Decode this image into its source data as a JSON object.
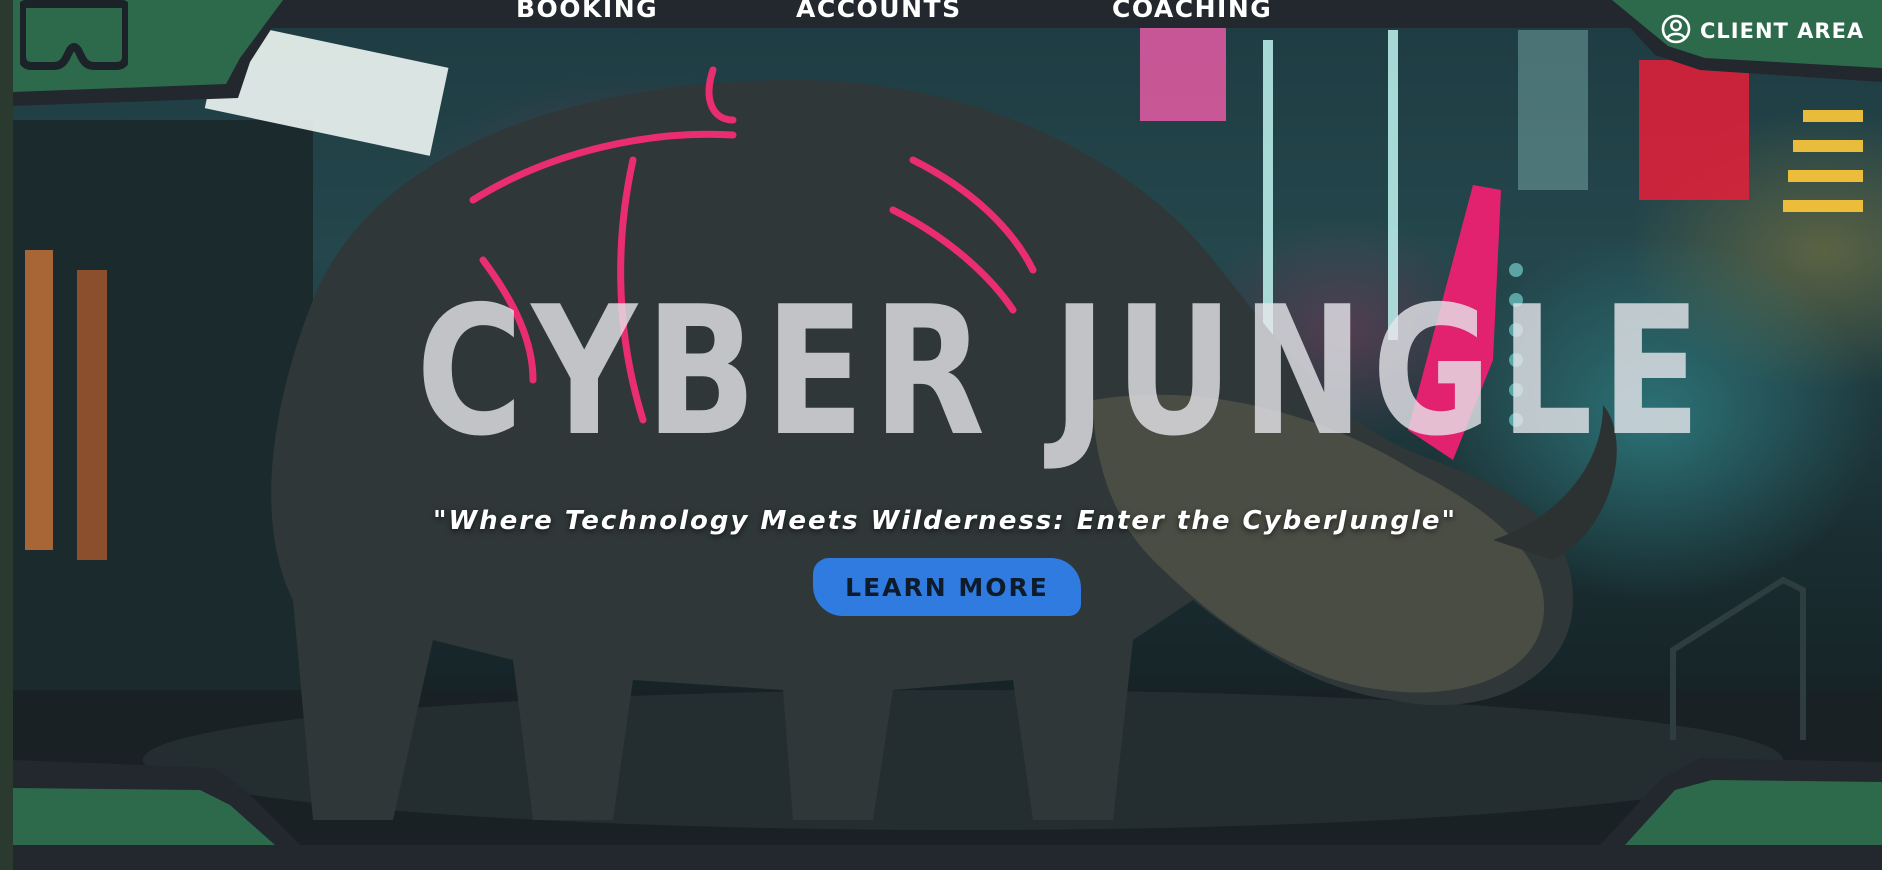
{
  "nav": {
    "links": [
      {
        "label": "Booking"
      },
      {
        "label": "Accounts"
      },
      {
        "label": "Coaching"
      }
    ],
    "client_area_label": "Client area",
    "logo_icon": "vr-headset-icon",
    "client_icon": "user-circle-icon"
  },
  "hero": {
    "title": "CYBER JUNGLE",
    "tagline": "\"Where Technology Meets Wilderness: Enter the CyberJungle\"",
    "cta_label": "Learn more",
    "background": "cyberpunk robotic rhinoceros in neon-lit alley"
  },
  "colors": {
    "frame_green": "#2d6a4c",
    "frame_dark": "#23282f",
    "cta_blue": "#2f7be0",
    "neon_pink": "#ff2d75"
  }
}
